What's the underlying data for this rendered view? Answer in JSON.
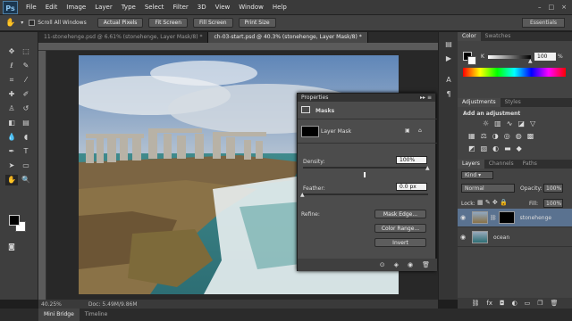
{
  "app": {
    "logo": "Ps",
    "menu": [
      "File",
      "Edit",
      "Image",
      "Layer",
      "Type",
      "Select",
      "Filter",
      "3D",
      "View",
      "Window",
      "Help"
    ],
    "window_controls": [
      "–",
      "□",
      "×"
    ]
  },
  "options": {
    "scroll_all": "Scroll All Windows",
    "actual_pixels": "Actual Pixels",
    "fit_screen": "Fit Screen",
    "fill_screen": "Fill Screen",
    "print_size": "Print Size",
    "workspace": "Essentials"
  },
  "tabs": [
    {
      "label": "11-stonehenge.psd @ 6.61% (stonehenge, Layer Mask/8) *",
      "active": false
    },
    {
      "label": "ch-03-start.psd @ 40.3% (stonehenge, Layer Mask/8) *",
      "active": true
    }
  ],
  "status": {
    "zoom": "40.25%",
    "doc": "Doc: 5.49M/9.86M"
  },
  "bottom_tabs": [
    "Mini Bridge",
    "Timeline"
  ],
  "properties": {
    "title": "Properties",
    "section": "Masks",
    "mask_label": "Layer Mask",
    "density_label": "Density:",
    "density": "100%",
    "feather_label": "Feather:",
    "feather": "0.0 px",
    "refine_label": "Refine:",
    "mask_edge": "Mask Edge...",
    "color_range": "Color Range...",
    "invert": "Invert",
    "density_pct": 100,
    "feather_pct": 0
  },
  "color_panel": {
    "tabs": [
      "Color",
      "Swatches"
    ],
    "k_label": "K",
    "k_value": "100",
    "k_pct": 100
  },
  "adjustments": {
    "tabs": [
      "Adjustments",
      "Styles"
    ],
    "heading": "Add an adjustment"
  },
  "layers_panel": {
    "tabs": [
      "Layers",
      "Channels",
      "Paths"
    ],
    "filter": "Kind",
    "blend": "Normal",
    "opacity_label": "Opacity:",
    "opacity": "100%",
    "lock_label": "Lock:",
    "fill_label": "Fill:",
    "fill": "100%",
    "layers": [
      {
        "name": "stonehenge",
        "selected": true
      },
      {
        "name": "ocean",
        "selected": false
      }
    ]
  }
}
